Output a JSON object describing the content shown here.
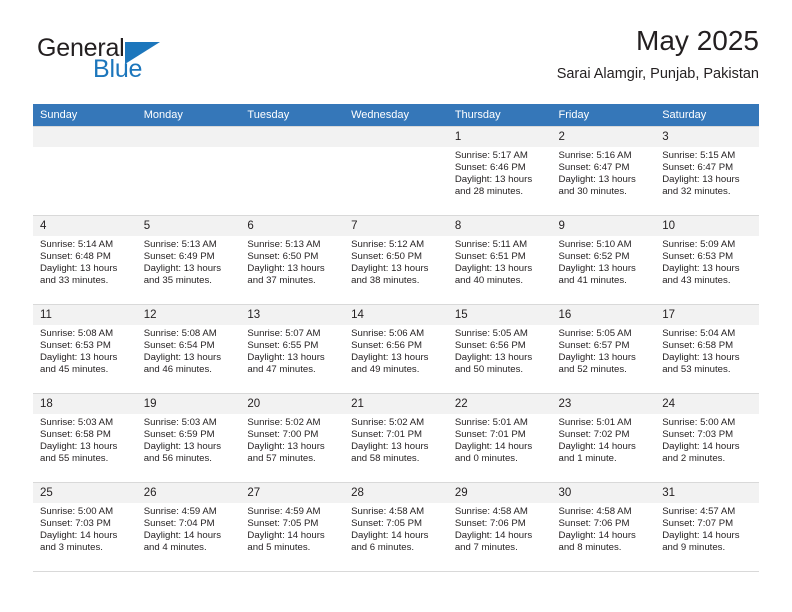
{
  "brand": {
    "word1": "General",
    "word2": "Blue",
    "accent_color": "#1c76bc",
    "logo_icon": "triangle-flag-icon"
  },
  "header": {
    "title": "May 2025",
    "subtitle": "Sarai Alamgir, Punjab, Pakistan"
  },
  "calendar": {
    "header_bg": "#3577b9",
    "shaded_row_bg": "#f2f2f2",
    "weekday_headers": [
      "Sunday",
      "Monday",
      "Tuesday",
      "Wednesday",
      "Thursday",
      "Friday",
      "Saturday"
    ],
    "weeks": [
      [
        {
          "day": "",
          "sunrise": "",
          "sunset": "",
          "daylight_1": "",
          "daylight_2": ""
        },
        {
          "day": "",
          "sunrise": "",
          "sunset": "",
          "daylight_1": "",
          "daylight_2": ""
        },
        {
          "day": "",
          "sunrise": "",
          "sunset": "",
          "daylight_1": "",
          "daylight_2": ""
        },
        {
          "day": "",
          "sunrise": "",
          "sunset": "",
          "daylight_1": "",
          "daylight_2": ""
        },
        {
          "day": "1",
          "sunrise": "Sunrise: 5:17 AM",
          "sunset": "Sunset: 6:46 PM",
          "daylight_1": "Daylight: 13 hours",
          "daylight_2": "and 28 minutes."
        },
        {
          "day": "2",
          "sunrise": "Sunrise: 5:16 AM",
          "sunset": "Sunset: 6:47 PM",
          "daylight_1": "Daylight: 13 hours",
          "daylight_2": "and 30 minutes."
        },
        {
          "day": "3",
          "sunrise": "Sunrise: 5:15 AM",
          "sunset": "Sunset: 6:47 PM",
          "daylight_1": "Daylight: 13 hours",
          "daylight_2": "and 32 minutes."
        }
      ],
      [
        {
          "day": "4",
          "sunrise": "Sunrise: 5:14 AM",
          "sunset": "Sunset: 6:48 PM",
          "daylight_1": "Daylight: 13 hours",
          "daylight_2": "and 33 minutes."
        },
        {
          "day": "5",
          "sunrise": "Sunrise: 5:13 AM",
          "sunset": "Sunset: 6:49 PM",
          "daylight_1": "Daylight: 13 hours",
          "daylight_2": "and 35 minutes."
        },
        {
          "day": "6",
          "sunrise": "Sunrise: 5:13 AM",
          "sunset": "Sunset: 6:50 PM",
          "daylight_1": "Daylight: 13 hours",
          "daylight_2": "and 37 minutes."
        },
        {
          "day": "7",
          "sunrise": "Sunrise: 5:12 AM",
          "sunset": "Sunset: 6:50 PM",
          "daylight_1": "Daylight: 13 hours",
          "daylight_2": "and 38 minutes."
        },
        {
          "day": "8",
          "sunrise": "Sunrise: 5:11 AM",
          "sunset": "Sunset: 6:51 PM",
          "daylight_1": "Daylight: 13 hours",
          "daylight_2": "and 40 minutes."
        },
        {
          "day": "9",
          "sunrise": "Sunrise: 5:10 AM",
          "sunset": "Sunset: 6:52 PM",
          "daylight_1": "Daylight: 13 hours",
          "daylight_2": "and 41 minutes."
        },
        {
          "day": "10",
          "sunrise": "Sunrise: 5:09 AM",
          "sunset": "Sunset: 6:53 PM",
          "daylight_1": "Daylight: 13 hours",
          "daylight_2": "and 43 minutes."
        }
      ],
      [
        {
          "day": "11",
          "sunrise": "Sunrise: 5:08 AM",
          "sunset": "Sunset: 6:53 PM",
          "daylight_1": "Daylight: 13 hours",
          "daylight_2": "and 45 minutes."
        },
        {
          "day": "12",
          "sunrise": "Sunrise: 5:08 AM",
          "sunset": "Sunset: 6:54 PM",
          "daylight_1": "Daylight: 13 hours",
          "daylight_2": "and 46 minutes."
        },
        {
          "day": "13",
          "sunrise": "Sunrise: 5:07 AM",
          "sunset": "Sunset: 6:55 PM",
          "daylight_1": "Daylight: 13 hours",
          "daylight_2": "and 47 minutes."
        },
        {
          "day": "14",
          "sunrise": "Sunrise: 5:06 AM",
          "sunset": "Sunset: 6:56 PM",
          "daylight_1": "Daylight: 13 hours",
          "daylight_2": "and 49 minutes."
        },
        {
          "day": "15",
          "sunrise": "Sunrise: 5:05 AM",
          "sunset": "Sunset: 6:56 PM",
          "daylight_1": "Daylight: 13 hours",
          "daylight_2": "and 50 minutes."
        },
        {
          "day": "16",
          "sunrise": "Sunrise: 5:05 AM",
          "sunset": "Sunset: 6:57 PM",
          "daylight_1": "Daylight: 13 hours",
          "daylight_2": "and 52 minutes."
        },
        {
          "day": "17",
          "sunrise": "Sunrise: 5:04 AM",
          "sunset": "Sunset: 6:58 PM",
          "daylight_1": "Daylight: 13 hours",
          "daylight_2": "and 53 minutes."
        }
      ],
      [
        {
          "day": "18",
          "sunrise": "Sunrise: 5:03 AM",
          "sunset": "Sunset: 6:58 PM",
          "daylight_1": "Daylight: 13 hours",
          "daylight_2": "and 55 minutes."
        },
        {
          "day": "19",
          "sunrise": "Sunrise: 5:03 AM",
          "sunset": "Sunset: 6:59 PM",
          "daylight_1": "Daylight: 13 hours",
          "daylight_2": "and 56 minutes."
        },
        {
          "day": "20",
          "sunrise": "Sunrise: 5:02 AM",
          "sunset": "Sunset: 7:00 PM",
          "daylight_1": "Daylight: 13 hours",
          "daylight_2": "and 57 minutes."
        },
        {
          "day": "21",
          "sunrise": "Sunrise: 5:02 AM",
          "sunset": "Sunset: 7:01 PM",
          "daylight_1": "Daylight: 13 hours",
          "daylight_2": "and 58 minutes."
        },
        {
          "day": "22",
          "sunrise": "Sunrise: 5:01 AM",
          "sunset": "Sunset: 7:01 PM",
          "daylight_1": "Daylight: 14 hours",
          "daylight_2": "and 0 minutes."
        },
        {
          "day": "23",
          "sunrise": "Sunrise: 5:01 AM",
          "sunset": "Sunset: 7:02 PM",
          "daylight_1": "Daylight: 14 hours",
          "daylight_2": "and 1 minute."
        },
        {
          "day": "24",
          "sunrise": "Sunrise: 5:00 AM",
          "sunset": "Sunset: 7:03 PM",
          "daylight_1": "Daylight: 14 hours",
          "daylight_2": "and 2 minutes."
        }
      ],
      [
        {
          "day": "25",
          "sunrise": "Sunrise: 5:00 AM",
          "sunset": "Sunset: 7:03 PM",
          "daylight_1": "Daylight: 14 hours",
          "daylight_2": "and 3 minutes."
        },
        {
          "day": "26",
          "sunrise": "Sunrise: 4:59 AM",
          "sunset": "Sunset: 7:04 PM",
          "daylight_1": "Daylight: 14 hours",
          "daylight_2": "and 4 minutes."
        },
        {
          "day": "27",
          "sunrise": "Sunrise: 4:59 AM",
          "sunset": "Sunset: 7:05 PM",
          "daylight_1": "Daylight: 14 hours",
          "daylight_2": "and 5 minutes."
        },
        {
          "day": "28",
          "sunrise": "Sunrise: 4:58 AM",
          "sunset": "Sunset: 7:05 PM",
          "daylight_1": "Daylight: 14 hours",
          "daylight_2": "and 6 minutes."
        },
        {
          "day": "29",
          "sunrise": "Sunrise: 4:58 AM",
          "sunset": "Sunset: 7:06 PM",
          "daylight_1": "Daylight: 14 hours",
          "daylight_2": "and 7 minutes."
        },
        {
          "day": "30",
          "sunrise": "Sunrise: 4:58 AM",
          "sunset": "Sunset: 7:06 PM",
          "daylight_1": "Daylight: 14 hours",
          "daylight_2": "and 8 minutes."
        },
        {
          "day": "31",
          "sunrise": "Sunrise: 4:57 AM",
          "sunset": "Sunset: 7:07 PM",
          "daylight_1": "Daylight: 14 hours",
          "daylight_2": "and 9 minutes."
        }
      ]
    ]
  }
}
